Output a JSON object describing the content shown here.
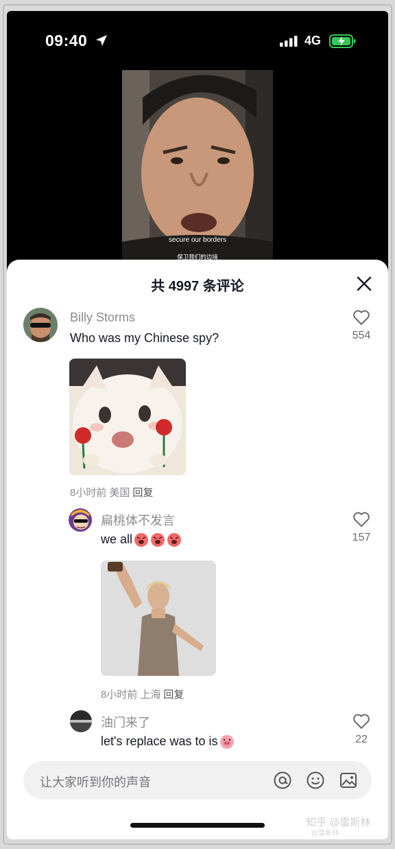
{
  "status_bar": {
    "time": "09:40",
    "network": "4G"
  },
  "video": {
    "subtitle_en": "secure our borders",
    "subtitle_zh": "保卫我们的边境"
  },
  "sheet": {
    "title": "共 4997 条评论"
  },
  "comments": [
    {
      "user": "Billy Storms",
      "text": "Who was my Chinese spy?",
      "likes": "554",
      "time": "8小时前",
      "location": "美国",
      "reply_label": "回复"
    },
    {
      "user": "扁桃体不发言",
      "text": "we all",
      "likes": "157",
      "time": "8小时前",
      "location": "上海",
      "reply_label": "回复"
    },
    {
      "user": "油门来了",
      "text": "let's replace was to is",
      "likes": "22"
    }
  ],
  "input": {
    "placeholder": "让大家听到你的声音"
  },
  "watermark": {
    "main": "知乎 @雷斯林",
    "sub": "@雷斯林"
  },
  "colors": {
    "like_red": "#fe2c55",
    "text_primary": "#161823",
    "text_secondary": "#8a8b91",
    "battery_green": "#34c759"
  }
}
